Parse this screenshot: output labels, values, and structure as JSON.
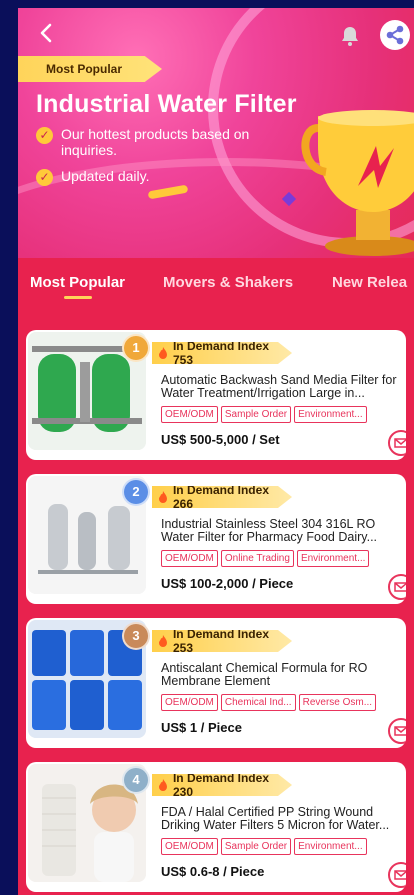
{
  "header": {
    "back_icon": "back-arrow-icon",
    "bell_icon": "bell-icon",
    "share_icon": "share-icon"
  },
  "hero": {
    "ribbon": "Most Popular",
    "title": "Industrial Water Filter",
    "bullets": [
      "Our hottest products based on inquiries.",
      "Updated daily."
    ]
  },
  "tabs": [
    {
      "label": "Most Popular",
      "active": true
    },
    {
      "label": "Movers & Shakers",
      "active": false
    },
    {
      "label": "New Relea",
      "active": false
    }
  ],
  "products": [
    {
      "rank": "1",
      "index_label": "In Demand Index 753",
      "title": "Automatic Backwash Sand Media Filter for Water Treatment/Irrigation Large in...",
      "tags": [
        "OEM/ODM",
        "Sample Order",
        "Environment..."
      ],
      "price": "US$ 500-5,000 / Set"
    },
    {
      "rank": "2",
      "index_label": "In Demand Index 266",
      "title": "Industrial Stainless Steel 304 316L RO Water Filter for Pharmacy Food Dairy...",
      "tags": [
        "OEM/ODM",
        "Online Trading",
        "Environment..."
      ],
      "price": "US$ 100-2,000 / Piece"
    },
    {
      "rank": "3",
      "index_label": "In Demand Index 253",
      "title": "Antiscalant Chemical Formula for RO Membrane Element",
      "tags": [
        "OEM/ODM",
        "Chemical Ind...",
        "Reverse Osm..."
      ],
      "price": "US$ 1 / Piece"
    },
    {
      "rank": "4",
      "index_label": "In Demand Index 230",
      "title": "FDA / Halal Certified PP String Wound Driking Water Filters 5 Micron for Water...",
      "tags": [
        "OEM/ODM",
        "Sample Order",
        "Environment..."
      ],
      "price": "US$ 0.6-8 / Piece"
    }
  ],
  "colors": {
    "background": "#e8224e",
    "accent": "#ffd45a",
    "tag": "#e8345c",
    "rank1": "#f0a83a",
    "rank2": "#5b8ee6",
    "rank3": "#c98a5a",
    "rank4": "#8fb0c9"
  }
}
